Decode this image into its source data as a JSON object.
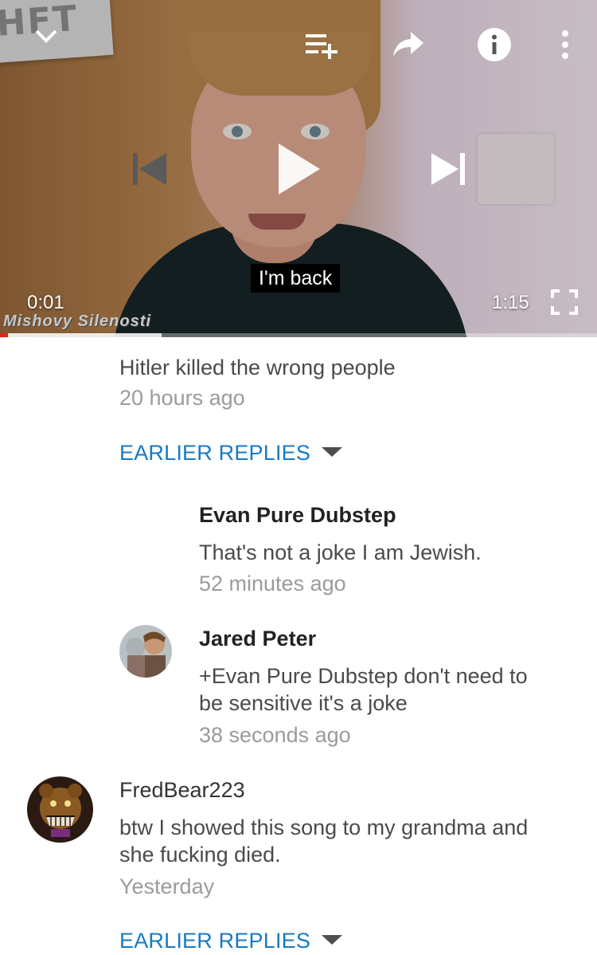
{
  "player": {
    "current_time": "0:01",
    "duration": "1:15",
    "caption": "I'm back",
    "watermark": "Mishovy Silenosti",
    "poster_text": "HFT",
    "progress": 0.013,
    "buffered": 0.27,
    "accent_color": "#e62117",
    "icons": [
      "chevron-down-icon",
      "add-to-playlist-icon",
      "share-icon",
      "info-icon",
      "more-vert-icon",
      "skip-previous-icon",
      "play-icon",
      "skip-next-icon",
      "fullscreen-icon"
    ]
  },
  "comments": {
    "top_reply": {
      "text": "Hitler killed the wrong people",
      "time": "20 hours ago"
    },
    "earlier_replies_label_1": "EARLIER REPLIES",
    "replies": [
      {
        "author": "Evan Pure Dubstep",
        "text": "That's not a joke I am Jewish.",
        "time": "52 minutes ago"
      },
      {
        "author": "Jared Peter",
        "text_line1": "+Evan Pure Dubstep don't need to",
        "text_line2": "be sensitive it's a joke",
        "time": "38 seconds ago"
      }
    ],
    "thread": {
      "author": "FredBear223",
      "text_line1": "btw I showed this song to my grandma and",
      "text_line2": "she fucking died.",
      "time": "Yesterday"
    },
    "earlier_replies_label_2": "EARLIER REPLIES",
    "link_color": "#167ac6"
  }
}
